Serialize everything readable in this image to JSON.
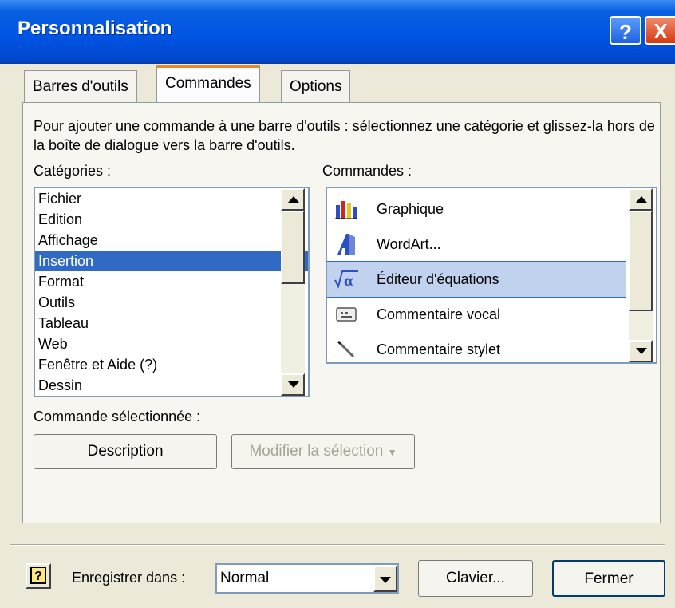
{
  "window": {
    "title": "Personnalisation",
    "help_glyph": "?",
    "close_glyph": "X"
  },
  "tabs": [
    {
      "label": "Barres d'outils",
      "active": false
    },
    {
      "label": "Commandes",
      "active": true
    },
    {
      "label": "Options",
      "active": false
    }
  ],
  "instruction": "Pour ajouter une commande à une barre d'outils : sélectionnez une catégorie et glissez-la hors de la boîte de dialogue vers la barre d'outils.",
  "categories": {
    "label": "Catégories :",
    "items": [
      "Fichier",
      "Edition",
      "Affichage",
      "Insertion",
      "Format",
      "Outils",
      "Tableau",
      "Web",
      "Fenêtre et Aide (?)",
      "Dessin"
    ],
    "selected": "Insertion"
  },
  "commands": {
    "label": "Commandes :",
    "items": [
      {
        "label": "Graphique",
        "icon": "chart-icon"
      },
      {
        "label": "WordArt...",
        "icon": "wordart-icon"
      },
      {
        "label": "Éditeur d'équations",
        "icon": "equation-icon"
      },
      {
        "label": "Commentaire vocal",
        "icon": "voice-comment-icon"
      },
      {
        "label": "Commentaire stylet",
        "icon": "pen-comment-icon"
      }
    ],
    "selected": "Éditeur d'équations"
  },
  "selected_command": {
    "label": "Commande sélectionnée :",
    "description_button": "Description",
    "modify_button": "Modifier la sélection"
  },
  "footer": {
    "save_in_label": "Enregistrer dans :",
    "save_in_value": "Normal",
    "keyboard_button": "Clavier...",
    "close_button": "Fermer"
  }
}
